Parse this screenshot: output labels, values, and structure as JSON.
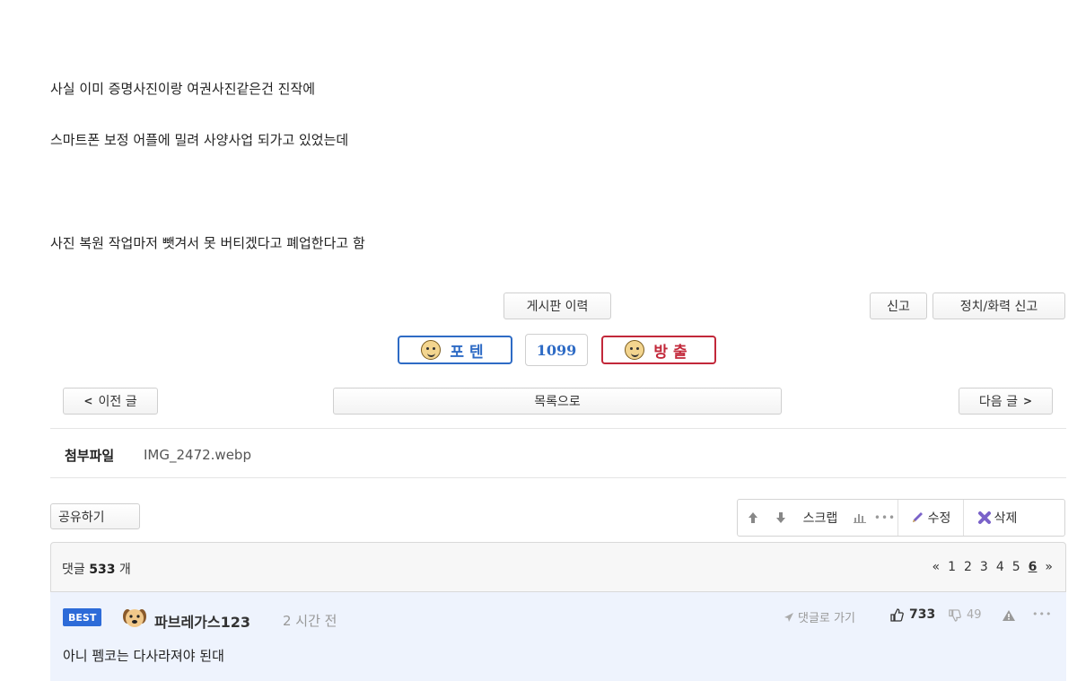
{
  "post": {
    "lines": [
      "사실 이미 증명사진이랑 여권사진같은건 진작에",
      "스마트폰 보정 어플에 밀려 사양사업 되가고 있었는데",
      "사진 복원 작업마저 뺏겨서 못 버티겠다고 폐업한다고 함"
    ]
  },
  "actions": {
    "history_label": "게시판 이력",
    "report_label": "신고",
    "political_report_label": "정치/화력 신고"
  },
  "votes": {
    "upvote_label": "포텐",
    "count": "1099",
    "ban_label": "방출"
  },
  "nav": {
    "prev_label": "이전 글",
    "prev_arrow": "<",
    "list_label": "목록으로",
    "next_label": "다음 글",
    "next_arrow": ">"
  },
  "attachment": {
    "label": "첨부파일",
    "filename": "IMG_2472.webp"
  },
  "share": {
    "label": "공유하기"
  },
  "toolbar": {
    "up_icon": "arrow-up-icon",
    "down_icon": "arrow-down-icon",
    "scrap_label": "스크랩",
    "stats_icon": "bar-chart-icon",
    "more_icon": "more-icon",
    "edit_label": "수정",
    "delete_label": "삭제"
  },
  "comments": {
    "label": "댓글",
    "count": "533",
    "unit": "개",
    "pagination": {
      "first": "«",
      "pages": [
        "1",
        "2",
        "3",
        "4",
        "5",
        "6"
      ],
      "current": "6",
      "last": "»"
    }
  },
  "best_comment": {
    "badge": "BEST",
    "author": "파브레가스123",
    "time": "2 시간 전",
    "goto_label": "댓글로 가기",
    "likes": "733",
    "dislikes": "49",
    "text": "아니 펨코는 다사라져야 된대"
  },
  "colors": {
    "best_badge": "#2d6bd8",
    "best_row_bg": "#eef3fd",
    "upvote_border": "#2e6bc5",
    "ban_border": "#c2283a",
    "ban_text": "#c2283a",
    "upvote_text": "#2e6bc5",
    "delete_icon": "#7a62c9"
  }
}
